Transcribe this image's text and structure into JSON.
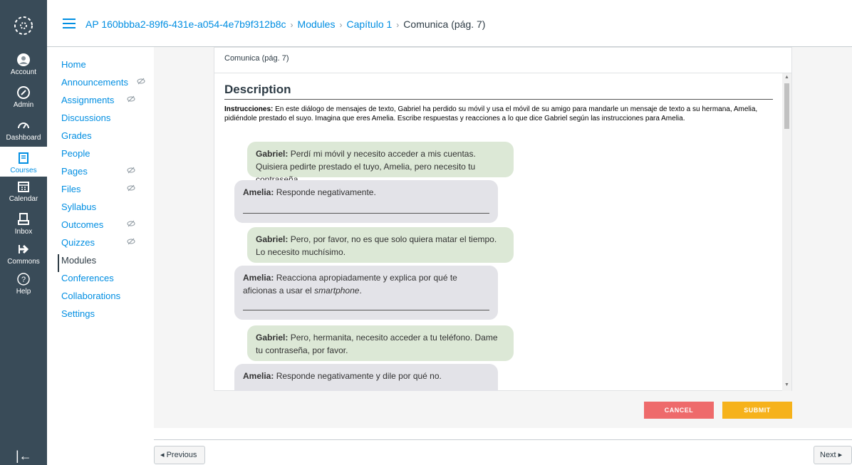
{
  "global_nav": {
    "items": [
      {
        "label": "Account",
        "icon": "account-icon"
      },
      {
        "label": "Admin",
        "icon": "admin-icon"
      },
      {
        "label": "Dashboard",
        "icon": "dashboard-icon"
      },
      {
        "label": "Courses",
        "icon": "courses-icon",
        "active": true
      },
      {
        "label": "Calendar",
        "icon": "calendar-icon"
      },
      {
        "label": "Inbox",
        "icon": "inbox-icon"
      },
      {
        "label": "Commons",
        "icon": "commons-icon"
      },
      {
        "label": "Help",
        "icon": "help-icon"
      }
    ],
    "collapse_icon": "|←"
  },
  "breadcrumb": {
    "course": "AP 160bbba2-89f6-431e-a054-4e7b9f312b8c",
    "modules": "Modules",
    "chapter": "Capítulo 1",
    "current": "Comunica (pág. 7)"
  },
  "course_nav": {
    "items": [
      {
        "label": "Home"
      },
      {
        "label": "Announcements"
      },
      {
        "label": "Assignments"
      },
      {
        "label": "Discussions"
      },
      {
        "label": "Grades"
      },
      {
        "label": "People"
      },
      {
        "label": "Pages"
      },
      {
        "label": "Files"
      },
      {
        "label": "Syllabus"
      },
      {
        "label": "Outcomes"
      },
      {
        "label": "Quizzes"
      },
      {
        "label": "Modules"
      },
      {
        "label": "Conferences"
      },
      {
        "label": "Collaborations"
      },
      {
        "label": "Settings"
      }
    ]
  },
  "panel": {
    "title": "Comunica (pág. 7)",
    "heading": "Description",
    "instructions_label": "Instrucciones:",
    "instructions_text": " En este diálogo de mensajes de texto, Gabriel ha perdido su móvil y usa el móvil de su amigo para mandarle un mensaje de texto a su hermana, Amelia, pidiéndole prestado el suyo. Imagina que eres Amelia. Escribe respuestas y reacciones a lo que dice Gabriel según las instrucciones para Amelia.",
    "messages": [
      {
        "speaker": "Gabriel:",
        "text": " Perdí mi móvil y necesito acceder a mis cuentas. Quisiera pedirte prestado el tuyo, Amelia, pero necesito tu contraseña."
      },
      {
        "speaker": "Amelia:",
        "text": " Responde negativamente."
      },
      {
        "speaker": "Gabriel:",
        "text": " Pero, por favor, no es que solo quiera matar el tiempo. Lo necesito muchísimo."
      },
      {
        "speaker": "Amelia:",
        "text": " Reacciona apropiadamente y explica por qué te aficionas a usar el ",
        "italic": "smartphone",
        "tail": "."
      },
      {
        "speaker": "Gabriel:",
        "text": " Pero, hermanita, necesito acceder a tu teléfono. Dame tu contraseña, por favor."
      },
      {
        "speaker": "Amelia:",
        "text": " Responde negativamente y dile por qué no."
      }
    ]
  },
  "actions": {
    "cancel": "CANCEL",
    "submit": "SUBMIT"
  },
  "footer": {
    "previous": "◂ Previous",
    "next": "Next ▸"
  },
  "colors": {
    "nav_bg": "#394b58",
    "link": "#008ee2",
    "cancel": "#ee6a6b",
    "submit": "#f6b21b"
  }
}
